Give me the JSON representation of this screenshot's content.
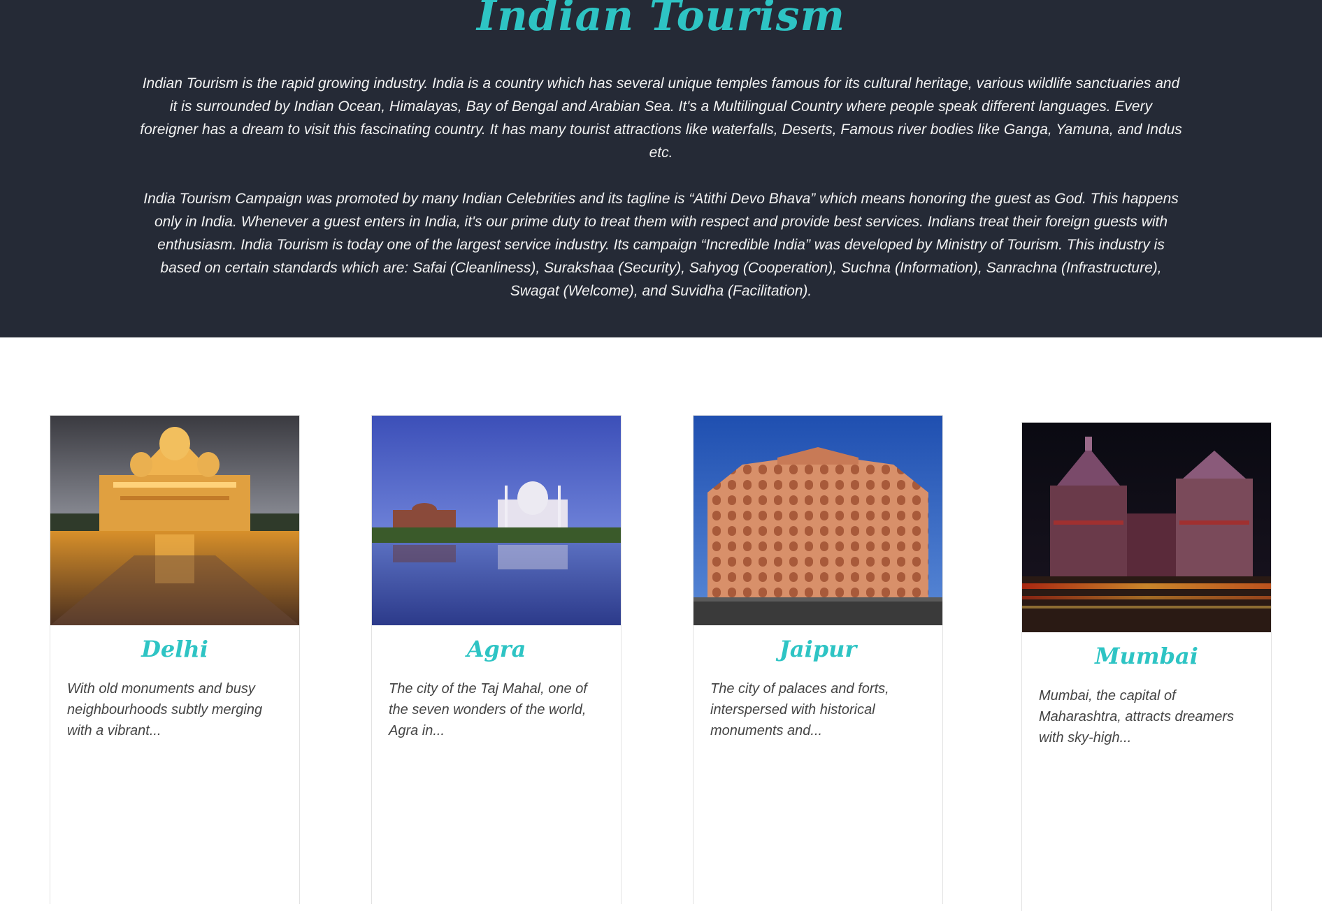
{
  "hero": {
    "title": "Indian Tourism",
    "paragraph1": "Indian Tourism is the rapid growing industry. India is a country which has several unique temples famous for its cultural heritage, various wildlife sanctuaries and it is surrounded by Indian Ocean, Himalayas, Bay of Bengal and Arabian Sea. It's a Multilingual Country where people speak different languages. Every foreigner has a dream to visit this fascinating country. It has many tourist attractions like waterfalls, Deserts, Famous river bodies like Ganga, Yamuna, and Indus etc.",
    "paragraph2": "India Tourism Campaign was promoted by many Indian Celebrities and its tagline is “Atithi Devo Bhava” which means honoring the guest as God. This happens only in India. Whenever a guest enters in India, it's our prime duty to treat them with respect and provide best services. Indians treat their foreign guests with enthusiasm. India Tourism is today one of the largest service industry. Its campaign “Incredible India” was developed by Ministry of Tourism. This industry is based on certain standards which are: Safai (Cleanliness), Surakshaa (Security), Sahyog (Cooperation), Suchna (Information), Sanrachna (Infrastructure), Swagat (Welcome), and Suvidha (Facilitation)."
  },
  "cards": [
    {
      "title": "Delhi",
      "text": "With old monuments and busy neighbourhoods subtly merging with a vibrant...",
      "image": "delhi-temple-photo"
    },
    {
      "title": "Agra",
      "text": "The city of the Taj Mahal, one of the seven wonders of the world, Agra in...",
      "image": "agra-taj-mahal-photo"
    },
    {
      "title": "Jaipur",
      "text": "The city of palaces and forts, interspersed with historical monuments and...",
      "image": "jaipur-hawa-mahal-photo"
    },
    {
      "title": "Mumbai",
      "text": "Mumbai, the capital of Maharashtra, attracts dreamers with sky-high...",
      "image": "mumbai-station-night-photo"
    }
  ],
  "colors": {
    "hero_bg": "#252a36",
    "accent": "#2ec4c4",
    "hero_text": "#f2f2f2",
    "card_text": "#444444"
  }
}
